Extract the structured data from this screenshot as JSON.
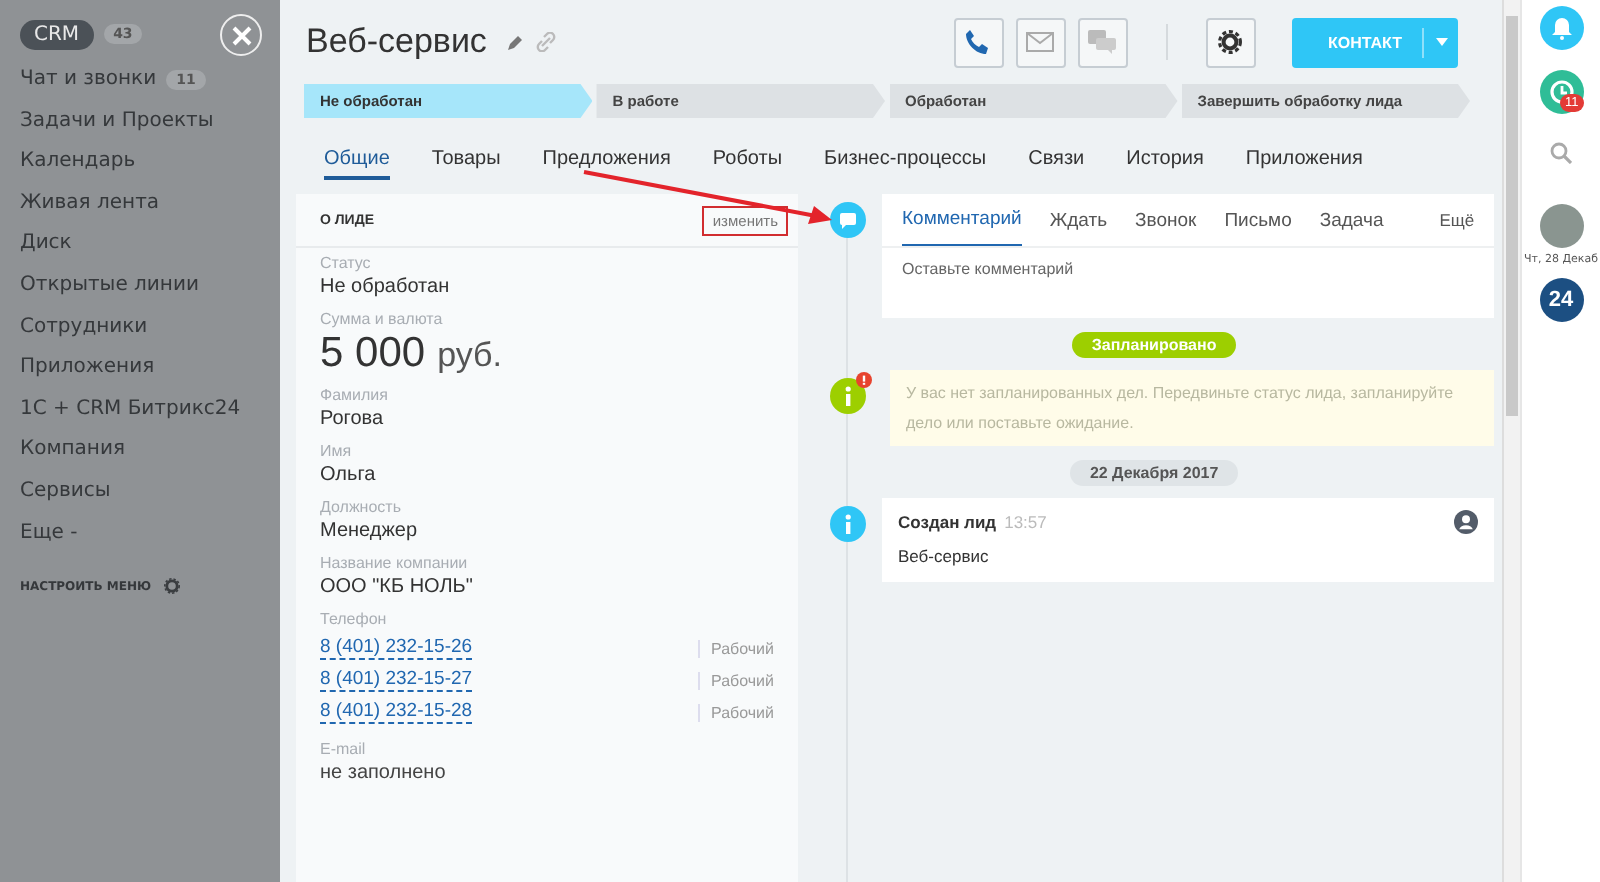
{
  "sidebar": {
    "crm": {
      "label": "CRM",
      "count": "43",
      "selected": true
    },
    "items": [
      {
        "label": "Чат и звонки",
        "count": "11"
      },
      {
        "label": "Задачи и Проекты"
      },
      {
        "label": "Календарь"
      },
      {
        "label": "Живая лента"
      },
      {
        "label": "Диск"
      },
      {
        "label": "Открытые линии"
      },
      {
        "label": "Сотрудники"
      },
      {
        "label": "Приложения"
      },
      {
        "label": "1С + CRM Битрикс24"
      },
      {
        "label": "Компания"
      },
      {
        "label": "Сервисы"
      }
    ],
    "more": "Еще -",
    "settings": "НАСТРОИТЬ МЕНЮ"
  },
  "header": {
    "title": "Веб-сервис",
    "primary_button": "КОНТАКТ"
  },
  "stages": [
    {
      "label": "Не обработан",
      "selected": true
    },
    {
      "label": "В работе",
      "selected": false
    },
    {
      "label": "Обработан",
      "selected": false
    },
    {
      "label": "Завершить обработку лида",
      "selected": false
    }
  ],
  "tabs": [
    {
      "label": "Общие",
      "selected": true
    },
    {
      "label": "Товары",
      "selected": false
    },
    {
      "label": "Предложения",
      "selected": false
    },
    {
      "label": "Роботы",
      "selected": false
    },
    {
      "label": "Бизнес-процессы",
      "selected": false
    },
    {
      "label": "Связи",
      "selected": false
    },
    {
      "label": "История",
      "selected": false
    },
    {
      "label": "Приложения",
      "selected": false
    }
  ],
  "lead_card": {
    "title": "О ЛИДЕ",
    "edit_button": "изменить",
    "fields": [
      {
        "kind": "text",
        "label": "Статус",
        "value": "Не обработан"
      },
      {
        "kind": "money",
        "label": "Сумма и валюта",
        "value": "5 000",
        "currency": "руб."
      },
      {
        "kind": "text",
        "label": "Фамилия",
        "value": "Рогова"
      },
      {
        "kind": "text",
        "label": "Имя",
        "value": "Ольга"
      },
      {
        "kind": "text",
        "label": "Должность",
        "value": "Менеджер"
      },
      {
        "kind": "text",
        "label": "Название компании",
        "value": "ООО \"КБ НОЛЬ\""
      },
      {
        "kind": "phones",
        "label": "Телефон",
        "phones": [
          {
            "number": "8 (401) 232-15-26",
            "type": "Рабочий"
          },
          {
            "number": "8 (401) 232-15-27",
            "type": "Рабочий"
          },
          {
            "number": "8 (401) 232-15-28",
            "type": "Рабочий"
          }
        ]
      },
      {
        "kind": "empty",
        "label": "E-mail",
        "value": "не заполнено"
      }
    ]
  },
  "timeline": {
    "composer": {
      "tabs": [
        {
          "label": "Комментарий",
          "selected": true
        },
        {
          "label": "Ждать",
          "selected": false
        },
        {
          "label": "Звонок",
          "selected": false
        },
        {
          "label": "Письмо",
          "selected": false
        },
        {
          "label": "Задача",
          "selected": false
        }
      ],
      "more": "Ещё",
      "placeholder": "Оставьте комментарий"
    },
    "planned_label": "Запланировано",
    "notice": "У вас нет запланированных дел. Передвиньте статус лида, запланируйте дело или поставьте ожидание.",
    "date_label": "22 Декабря 2017",
    "event": {
      "title": "Создан лид",
      "time": "13:57",
      "text": "Веб-сервис"
    }
  },
  "right_panel": {
    "badge": "11",
    "date": "Чт, 28 Декаб",
    "logo": "24"
  }
}
